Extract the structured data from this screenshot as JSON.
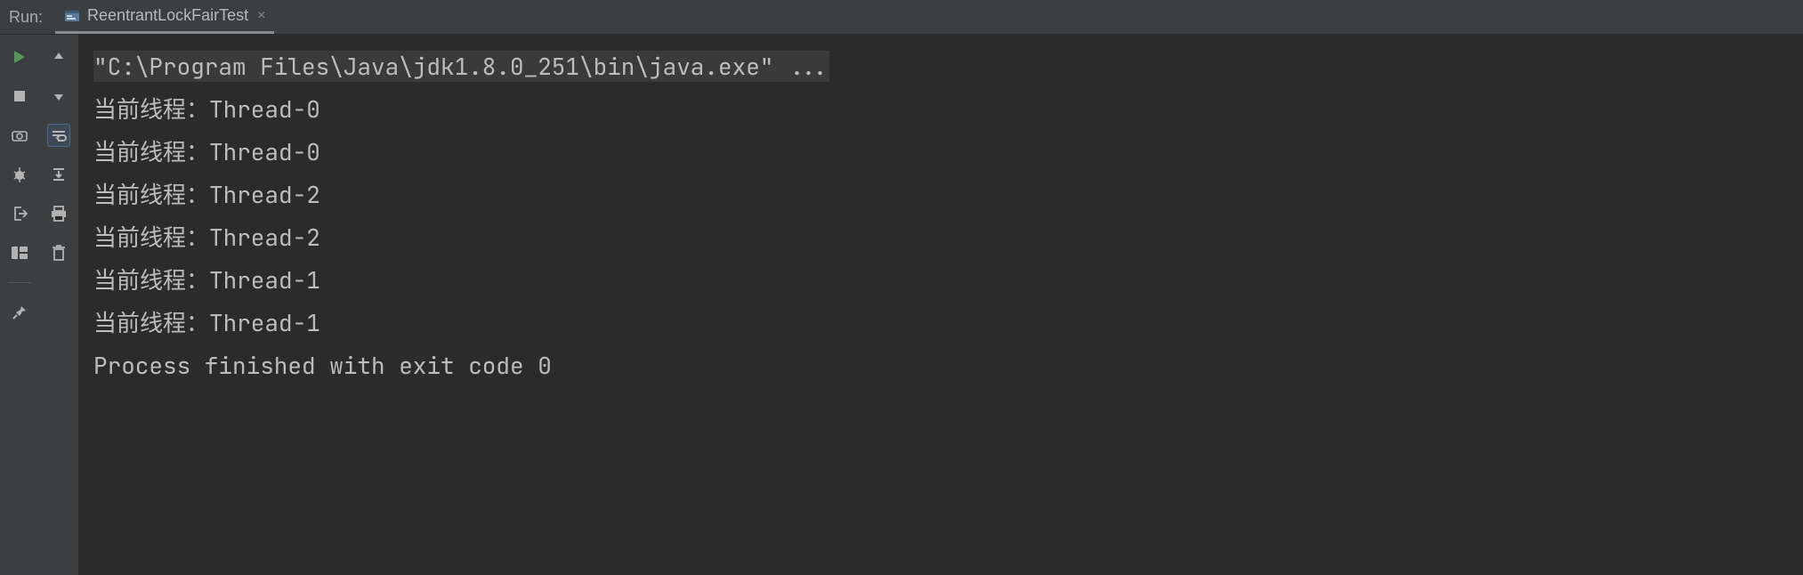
{
  "header": {
    "run_label": "Run:",
    "tab_title": "ReentrantLockFairTest",
    "close_glyph": "×"
  },
  "console": {
    "command": "\"C:\\Program Files\\Java\\jdk1.8.0_251\\bin\\java.exe\" ...",
    "lines": [
      "当前线程：Thread-0",
      "当前线程：Thread-0",
      "当前线程：Thread-2",
      "当前线程：Thread-2",
      "当前线程：Thread-1",
      "当前线程：Thread-1"
    ],
    "exit_line": "Process finished with exit code 0"
  }
}
